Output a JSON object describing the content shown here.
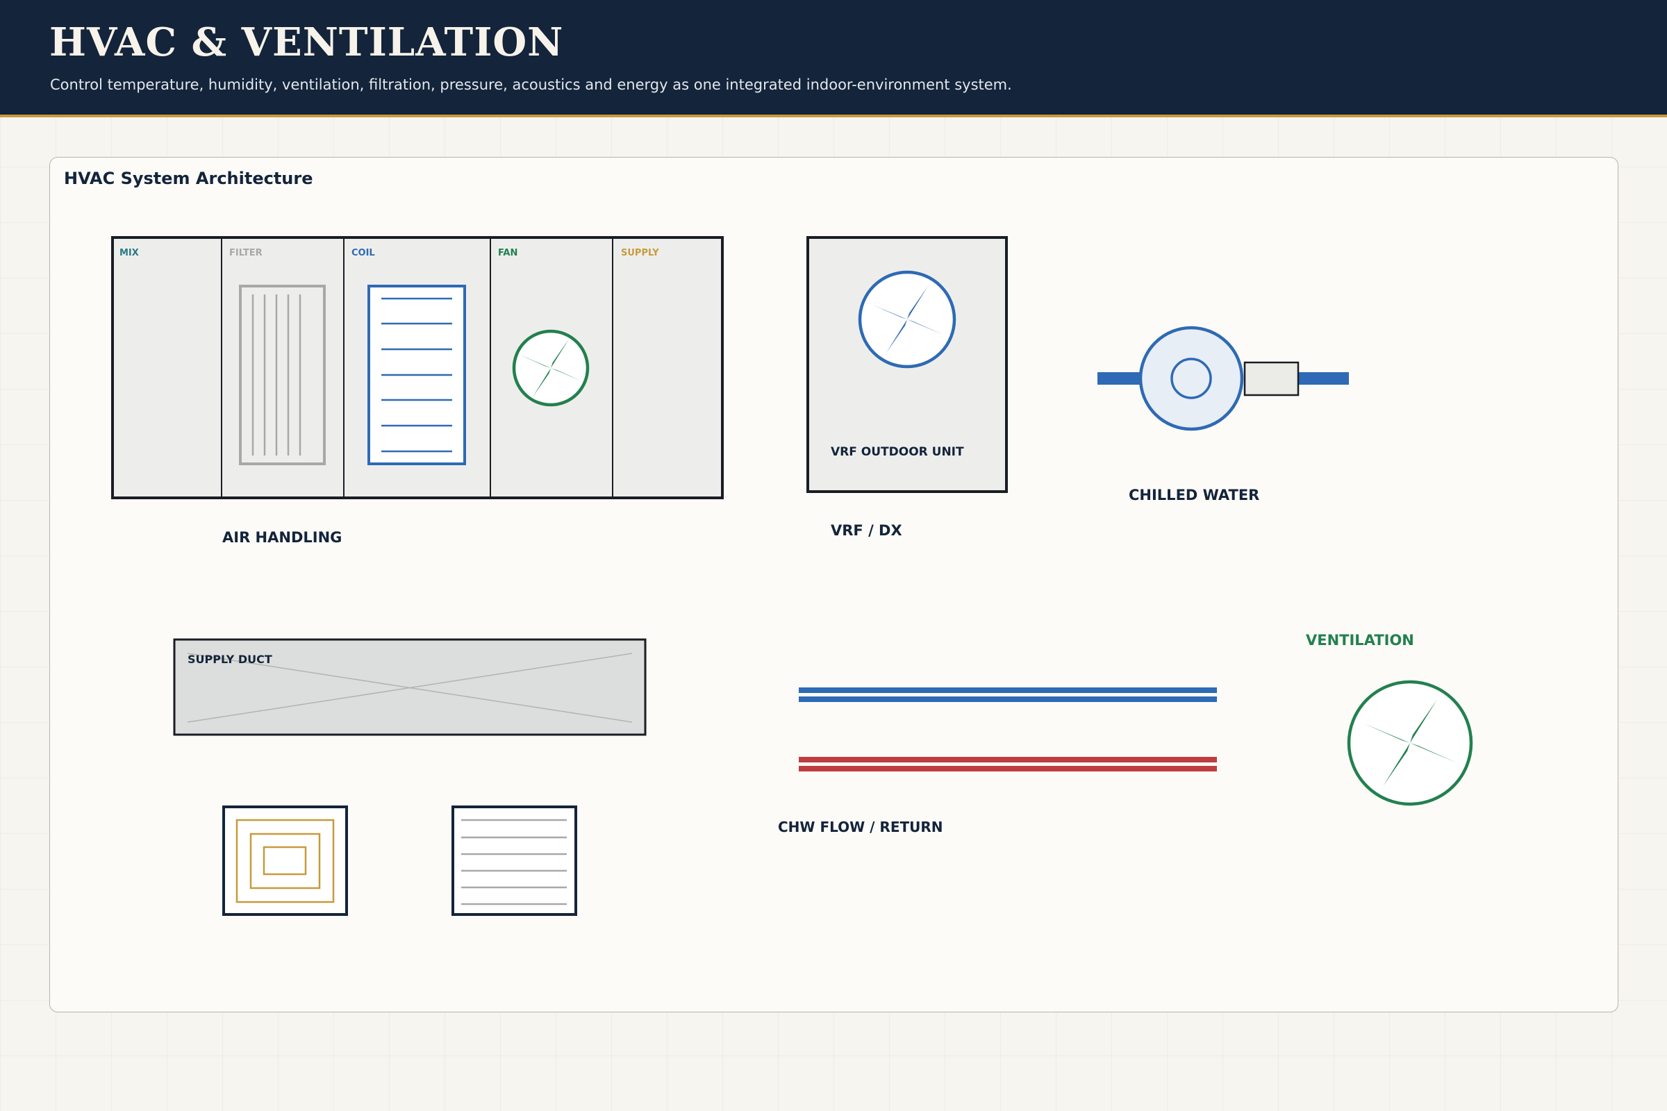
{
  "header": {
    "title": "HVAC & VENTILATION",
    "subtitle": "Control temperature, humidity, ventilation, filtration, pressure, acoustics and energy as one integrated indoor-environment system."
  },
  "panel": {
    "title": "HVAC System Architecture"
  },
  "air_handling": {
    "sections": {
      "mix": "MIX",
      "filter": "FILTER",
      "coil": "COIL",
      "fan": "FAN",
      "supply": "SUPPLY"
    },
    "caption": "AIR HANDLING"
  },
  "vrf": {
    "unit_label": "VRF OUTDOOR UNIT",
    "caption": "VRF / DX"
  },
  "chilled_water": {
    "caption": "CHILLED WATER"
  },
  "duct": {
    "label": "SUPPLY DUCT"
  },
  "piping": {
    "caption": "CHW FLOW / RETURN"
  },
  "ventilation": {
    "caption": "VENTILATION"
  },
  "colors": {
    "navy": "#13243b",
    "gold": "#c89a3c",
    "blue": "#2e6ab5",
    "green": "#23804f",
    "red": "#bf3d3d",
    "teal": "#2a7a86",
    "grey": "#a8a8a8"
  },
  "icons": [
    "fan-icon",
    "filter-icon",
    "coil-icon",
    "pump-icon",
    "ceiling-diffuser-icon",
    "return-grille-icon"
  ]
}
